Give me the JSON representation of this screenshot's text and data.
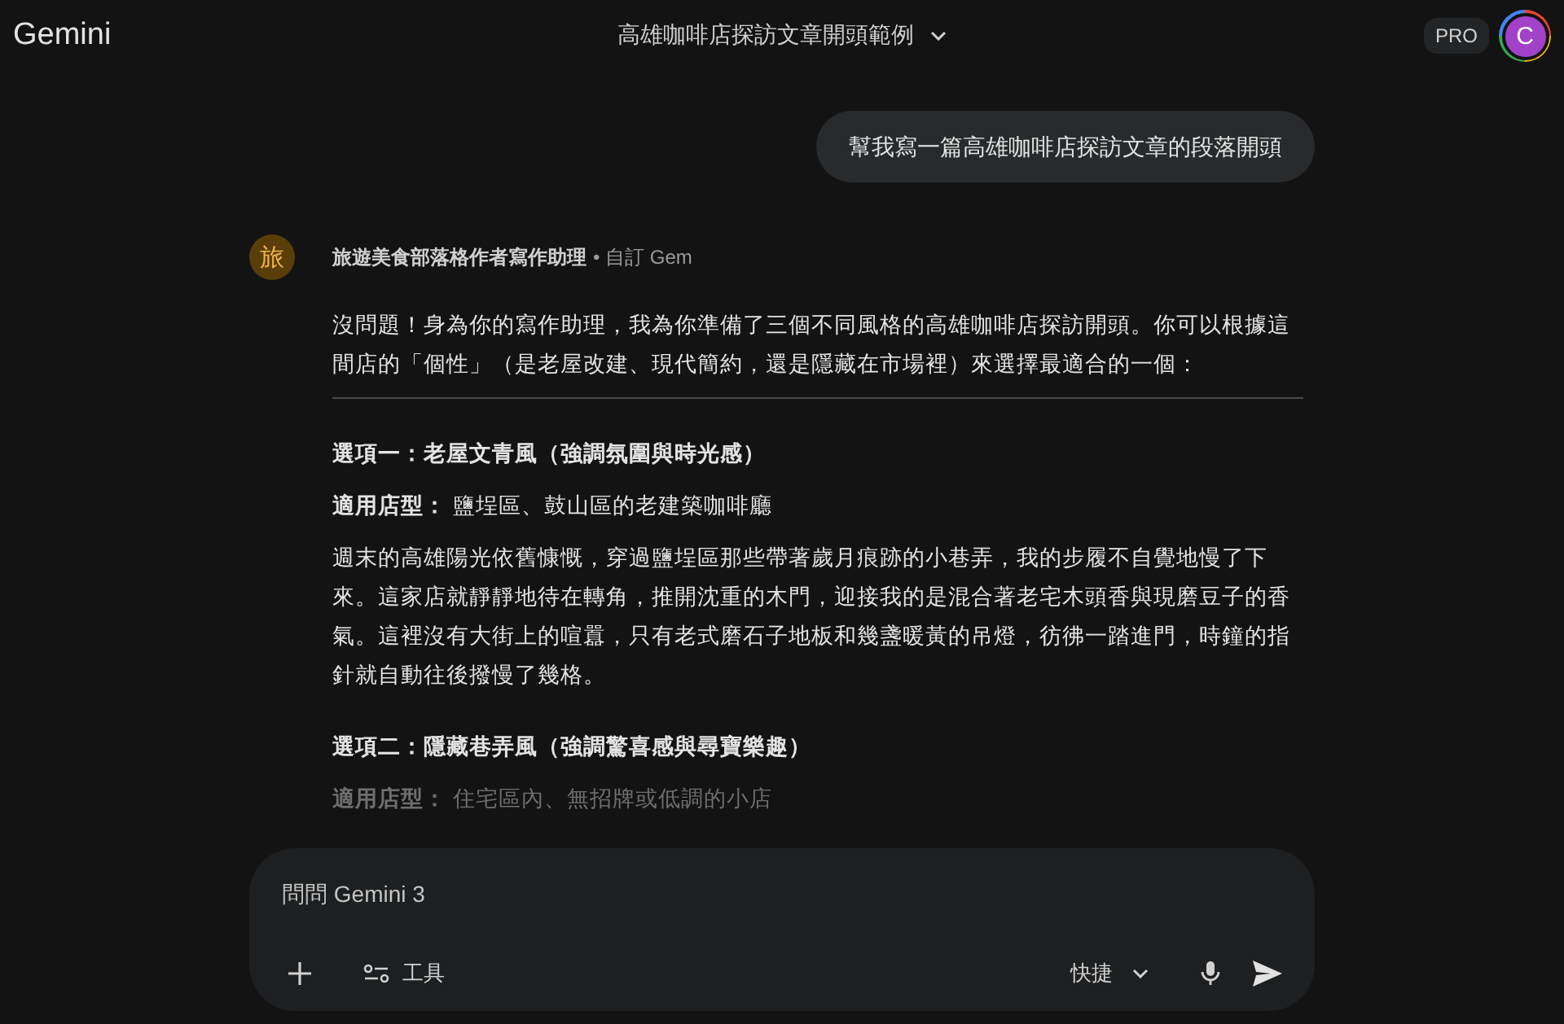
{
  "header": {
    "brand": "Gemini",
    "title": "高雄咖啡店探訪文章開頭範例",
    "badge": "PRO",
    "avatar_letter": "C"
  },
  "user_message": "幫我寫一篇高雄咖啡店探訪文章的段落開頭",
  "response": {
    "avatar_char": "旅",
    "gem_name": "旅遊美食部落格作者寫作助理",
    "gem_tag": "• 自訂 Gem",
    "blocks": [
      {
        "kind": "paragraph",
        "text": "沒問題！身為你的寫作助理，我為你準備了三個不同風格的高雄咖啡店探訪開頭。你可以根據這間店的「個性」（是老屋改建、現代簡約，還是隱藏在市場裡）來選擇最適合的一個："
      },
      {
        "kind": "divider"
      },
      {
        "kind": "heading",
        "text": "選項一：老屋文青風（強調氛圍與時光感）"
      },
      {
        "kind": "paragraph",
        "text": "**適用店型：** 鹽埕區、鼓山區的老建築咖啡廳"
      },
      {
        "kind": "paragraph",
        "text": "週末的高雄陽光依舊慷慨，穿過鹽埕區那些帶著歲月痕跡的小巷弄，我的步履不自覺地慢了下來。這家店就靜靜地待在轉角，推開沈重的木門，迎接我的是混合著老宅木頭香與現磨豆子的香氣。這裡沒有大街上的喧囂，只有老式磨石子地板和幾盞暖黃的吊燈，彷彿一踏進門，時鐘的指針就自動往後撥慢了幾格。"
      },
      {
        "kind": "heading",
        "text": "選項二：隱藏巷弄風（強調驚喜感與尋寶樂趣）"
      },
      {
        "kind": "paragraph",
        "text": "**適用店型：** 住宅區內、無招牌或低調的小店"
      }
    ]
  },
  "composer": {
    "placeholder": "問問 Gemini 3",
    "tools_label": "工具",
    "mode_label": "快捷"
  }
}
